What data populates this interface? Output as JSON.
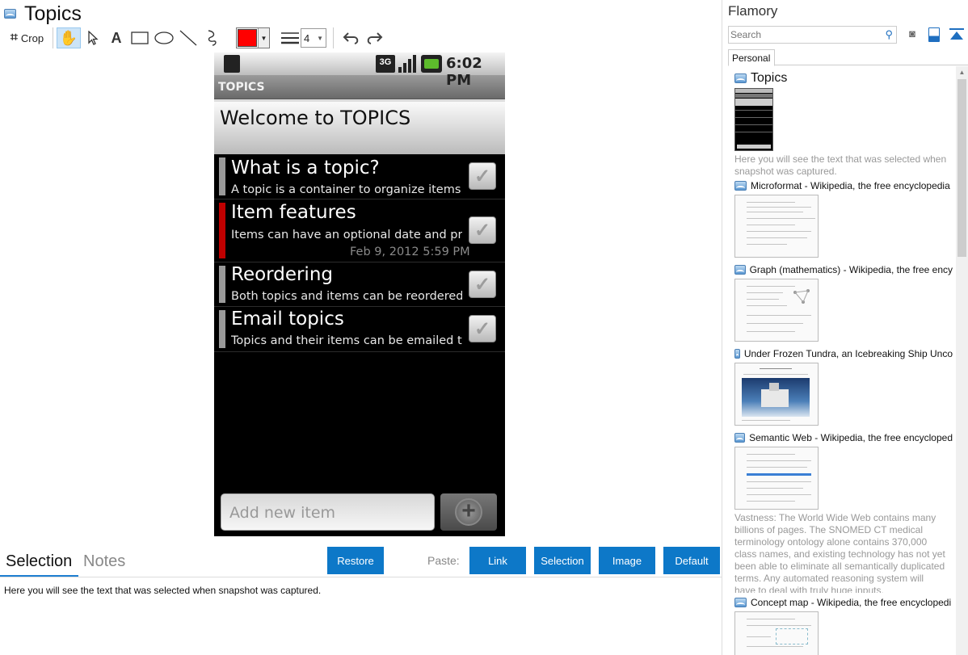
{
  "window": {
    "title": "Topics"
  },
  "toolbar": {
    "crop_label": "Crop",
    "line_width": "4",
    "color": "#ff0000"
  },
  "phone": {
    "time": "6:02 PM",
    "network": "3G",
    "app_title": "TOPICS",
    "welcome": "Welcome to TOPICS",
    "rows": [
      {
        "title": "What is a topic?",
        "desc": "A topic is a container to organize items of",
        "date": "",
        "accent": "#9a9a9a"
      },
      {
        "title": "Item features",
        "desc": "Items can have an optional date and priority",
        "date": "Feb 9, 2012 5:59 PM",
        "accent": "#c00000"
      },
      {
        "title": "Reordering",
        "desc": "Both topics and items can be reordered by",
        "date": "",
        "accent": "#9a9a9a"
      },
      {
        "title": "Email topics",
        "desc": "Topics and their items can be emailed to you",
        "date": "",
        "accent": "#9a9a9a"
      }
    ],
    "input_placeholder": "Add new item"
  },
  "bottom": {
    "tabs": [
      "Selection",
      "Notes"
    ],
    "restore": "Restore",
    "paste_label": "Paste:",
    "paste_buttons": [
      "Link",
      "Selection",
      "Image",
      "Default"
    ],
    "selection_text": "Here you will see the text that was selected when snapshot was captured."
  },
  "sidebar": {
    "title": "Flamory",
    "search_placeholder": "Search",
    "tab": "Personal",
    "snapshots": [
      {
        "title": "Topics",
        "desc": "Here you will see the text that was selected when snapshot was captured."
      },
      {
        "title": "Microformat - Wikipedia, the free encyclopedia",
        "desc": ""
      },
      {
        "title": "Graph (mathematics) - Wikipedia, the free ency",
        "desc": ""
      },
      {
        "title": "Under Frozen Tundra, an Icebreaking Ship Unco",
        "desc": ""
      },
      {
        "title": "Semantic Web - Wikipedia, the free encycloped",
        "desc": "Vastness: The World Wide Web contains many billions of pages. The SNOMED CT medical terminology ontology alone contains 370,000 class names, and existing technology has not yet been able to eliminate all semantically duplicated terms. Any automated reasoning system will have to deal with truly huge inputs."
      },
      {
        "title": "Concept map - Wikipedia, the free encyclopedi",
        "desc": ""
      }
    ]
  }
}
